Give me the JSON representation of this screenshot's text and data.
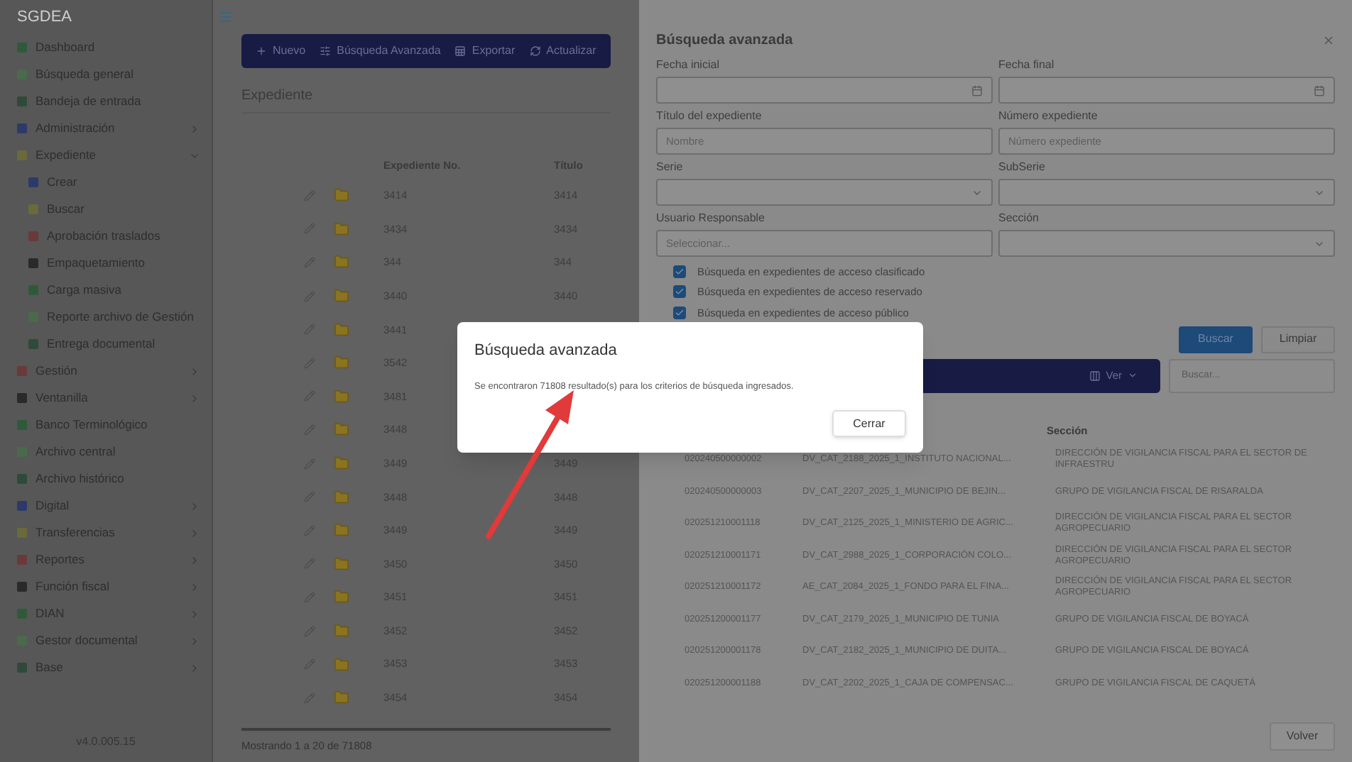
{
  "sidebar": {
    "title": "SGDEA",
    "version": "v4.0.005.15",
    "items": [
      {
        "label": "Dashboard"
      },
      {
        "label": "Búsqueda general"
      },
      {
        "label": "Bandeja de entrada"
      },
      {
        "label": "Administración",
        "expanded": false
      },
      {
        "label": "Expediente",
        "expanded": true,
        "children": [
          {
            "label": "Crear"
          },
          {
            "label": "Buscar"
          },
          {
            "label": "Aprobación traslados"
          },
          {
            "label": "Empaquetamiento"
          },
          {
            "label": "Carga masiva"
          },
          {
            "label": "Reporte archivo de Gestión"
          },
          {
            "label": "Entrega documental"
          }
        ]
      },
      {
        "label": "Gestión",
        "expanded": false
      },
      {
        "label": "Ventanilla",
        "expanded": false
      },
      {
        "label": "Banco Terminológico"
      },
      {
        "label": "Archivo central"
      },
      {
        "label": "Archivo histórico"
      },
      {
        "label": "Digital",
        "expanded": false
      },
      {
        "label": "Transferencias",
        "expanded": false
      },
      {
        "label": "Reportes",
        "expanded": false
      },
      {
        "label": "Función fiscal",
        "expanded": false
      },
      {
        "label": "DIAN",
        "expanded": false
      },
      {
        "label": "Gestor documental",
        "expanded": false
      },
      {
        "label": "Base",
        "expanded": false
      }
    ]
  },
  "toolbar": {
    "buttons": [
      {
        "label": "Nuevo"
      },
      {
        "label": "Búsqueda Avanzada"
      },
      {
        "label": "Exportar"
      },
      {
        "label": "Actualizar"
      }
    ]
  },
  "main": {
    "title": "Expediente",
    "columns": [
      "Expediente No.",
      "Título"
    ],
    "rows": [
      [
        "3414",
        "3414"
      ],
      [
        "3434",
        "3434"
      ],
      [
        "344",
        "344"
      ],
      [
        "3440",
        "3440"
      ],
      [
        "3441"
      ],
      [
        "3542"
      ],
      [
        "3481"
      ],
      [
        "3448"
      ],
      [
        "3449",
        "3449"
      ],
      [
        "3448",
        "3448"
      ],
      [
        "3449",
        "3449"
      ],
      [
        "3450",
        "3450"
      ],
      [
        "3451",
        "3451"
      ],
      [
        "3452",
        "3452"
      ],
      [
        "3453",
        "3453"
      ],
      [
        "3454",
        "3454"
      ]
    ],
    "footer": "Mostrando 1 a 20 de 71808"
  },
  "drawer": {
    "title": "Búsqueda avanzada",
    "fields": [
      {
        "kind": "date",
        "label": "Fecha inicial"
      },
      {
        "kind": "date",
        "label": "Fecha final"
      },
      {
        "kind": "text",
        "label": "Título del expediente",
        "placeholder": "Nombre"
      },
      {
        "kind": "text",
        "label": "Número expediente",
        "placeholder": "Número expediente"
      },
      {
        "kind": "select",
        "label": "Serie"
      },
      {
        "kind": "select",
        "label": "SubSerie"
      },
      {
        "kind": "text",
        "label": "Usuario Responsable",
        "placeholder": "Seleccionar..."
      },
      {
        "kind": "select",
        "label": "Sección"
      }
    ],
    "checkboxes": [
      {
        "label": "Búsqueda en expedientes de acceso clasificado",
        "checked": true
      },
      {
        "label": "Búsqueda en expedientes de acceso reservado",
        "checked": true
      },
      {
        "label": "Búsqueda en expedientes de acceso público",
        "checked": true
      }
    ],
    "search_button": "Buscar",
    "clear_button": "Limpiar",
    "results": {
      "view_button": "Ver",
      "search": {
        "placeholder": "Buscar..."
      },
      "column_3": "Sección",
      "rows": [
        [
          "020240500000002",
          "DV_CAT_2188_2025_1_INSTITUTO NACIONAL...",
          "DIRECCIÓN DE VIGILANCIA FISCAL PARA EL SECTOR DE INFRAESTRU"
        ],
        [
          "020240500000003",
          "DV_CAT_2207_2025_1_MUNICIPIO DE BEJIN...",
          "GRUPO DE VIGILANCIA FISCAL DE RISARALDA"
        ],
        [
          "020251210001118",
          "DV_CAT_2125_2025_1_MINISTERIO DE AGRIC...",
          "DIRECCIÓN DE VIGILANCIA FISCAL PARA EL SECTOR AGROPECUARIO"
        ],
        [
          "020251210001171",
          "DV_CAT_2988_2025_1_CORPORACIÓN COLO...",
          "DIRECCIÓN DE VIGILANCIA FISCAL PARA EL SECTOR AGROPECUARIO"
        ],
        [
          "020251210001172",
          "AE_CAT_2084_2025_1_FONDO PARA EL FINA...",
          "DIRECCIÓN DE VIGILANCIA FISCAL PARA EL SECTOR AGROPECUARIO"
        ],
        [
          "020251200001177",
          "DV_CAT_2179_2025_1_MUNICIPIO DE TUNIA",
          "GRUPO DE VIGILANCIA FISCAL DE BOYACÁ"
        ],
        [
          "020251200001178",
          "DV_CAT_2182_2025_1_MUNICIPIO DE DUITA...",
          "GRUPO DE VIGILANCIA FISCAL DE BOYACÁ"
        ],
        [
          "020251200001188",
          "DV_CAT_2202_2025_1_CAJA DE COMPENSAC...",
          "GRUPO DE VIGILANCIA FISCAL DE CAQUETÁ"
        ]
      ]
    },
    "back_button": "Volver"
  },
  "dialog": {
    "title": "Búsqueda avanzada",
    "message": "Se encontraron 71808 resultado(s) para los criterios de búsqueda ingresados.",
    "close_button": "Cerrar"
  }
}
